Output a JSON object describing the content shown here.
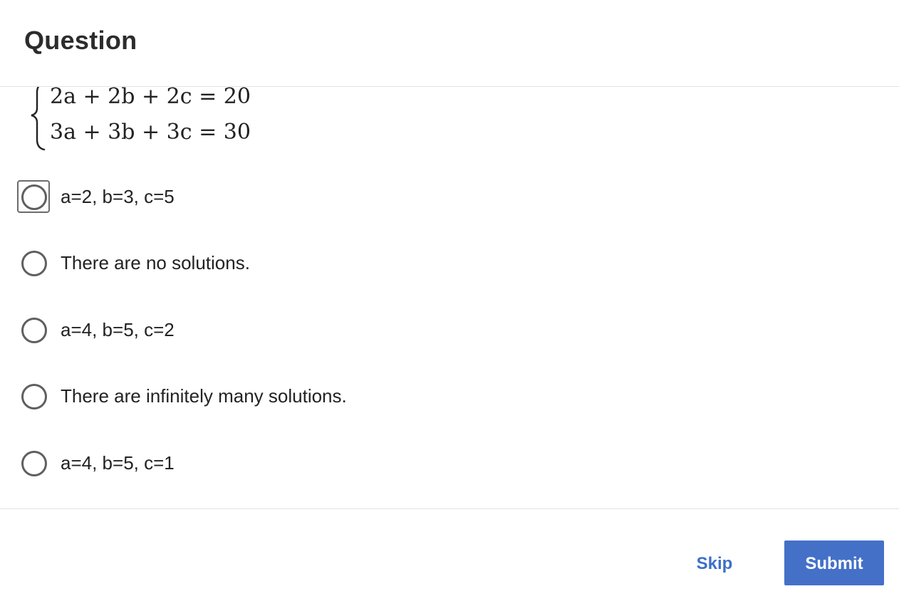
{
  "header": {
    "title": "Question"
  },
  "question": {
    "equations": [
      "2a + 2b + 2c = 20",
      "3a + 3b + 3c = 30"
    ]
  },
  "options": [
    {
      "label": "a=2, b=3, c=5",
      "focused": true
    },
    {
      "label": "There are no solutions.",
      "focused": false
    },
    {
      "label": "a=4, b=5, c=2",
      "focused": false
    },
    {
      "label": "There are infinitely many solutions.",
      "focused": false
    },
    {
      "label": "a=4, b=5, c=1",
      "focused": false
    }
  ],
  "footer": {
    "skip_label": "Skip",
    "submit_label": "Submit"
  },
  "colors": {
    "accent": "#4470c8",
    "link": "#3d6fc7",
    "radio_border": "#5f5f5f"
  }
}
